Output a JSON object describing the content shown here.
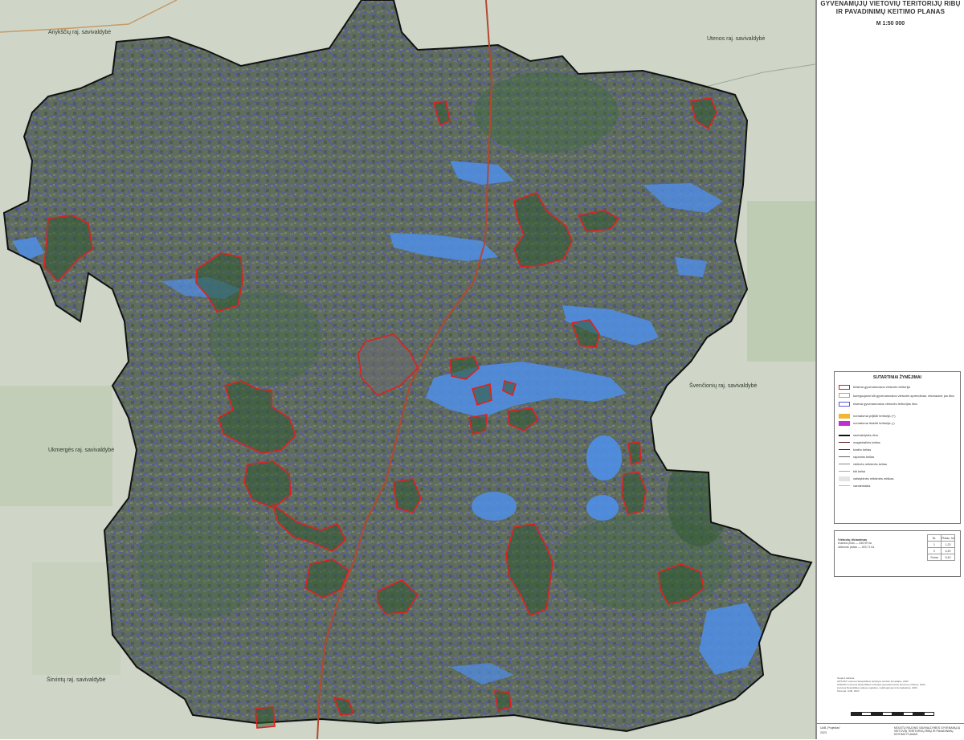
{
  "title": {
    "line1": "GYVENAMŲJŲ VIETOVIŲ TERITORIJŲ RIBŲ",
    "line2": "IR PAVADINIMŲ KEITIMO PLANAS",
    "scale": "M 1:50 000"
  },
  "neighbors": {
    "anyksciai": "Anykščių raj. savivaldybė",
    "utena": "Utenos raj. savivaldybė",
    "svencionys": "Švenčionių raj. savivaldybė",
    "ukmerge": "Ukmergės raj. savivaldybė",
    "sirvintos": "Širvintų raj. savivaldybė"
  },
  "legend": {
    "title": "SUTARTINIAI ŽYMĖJIMAI",
    "items": [
      {
        "label": "būsima gyvenamosios vietovės teritorija",
        "color": "#d81e1e",
        "kind": "box"
      },
      {
        "label": "koreguojami kiti gyvenamosios vietovės sprendiniai, rekreacinė jos riba",
        "color": "#c9a25a",
        "kind": "box"
      },
      {
        "label": "esama gyvenamosios vietovės teritorijos riba",
        "color": "#5a5ad6",
        "kind": "box"
      },
      {
        "label": "numatoma prijiktii teritorija (+)",
        "color": "#f2b632",
        "kind": "fill"
      },
      {
        "label": "numatoma išskirti teritorija (-)",
        "color": "#c02fd2",
        "kind": "fill"
      },
      {
        "label": "savivaldybės riba",
        "color": "#111111",
        "kind": "line"
      },
      {
        "label": "magistralinis kelias",
        "color": "#5a1a1a",
        "kind": "line"
      },
      {
        "label": "krašto kelias",
        "color": "#333333",
        "kind": "line"
      },
      {
        "label": "rajoninis kelias",
        "color": "#666666",
        "kind": "line"
      },
      {
        "label": "vietinės reikšmės kelias",
        "color": "#888888",
        "kind": "line"
      },
      {
        "label": "kiti keliai",
        "color": "#aaaaaa",
        "kind": "line"
      },
      {
        "label": "valstybinės reikšmės miškas",
        "color": "#e4e4e4",
        "kind": "fill"
      },
      {
        "label": "vandentakis",
        "color": "#bbbbbb",
        "kind": "line"
      }
    ]
  },
  "stats": {
    "label": "Vietovių rikiavimas",
    "lines": [
      "esamos ploto — 445,99 ha",
      "siūlomas plotas — 449,71 ha"
    ],
    "table": [
      [
        "Nr.",
        "Plotas, ha"
      ],
      [
        "1",
        "1,23"
      ],
      [
        "2",
        "4,20"
      ],
      [
        "Suma",
        "5,43"
      ]
    ]
  },
  "notes": [
    "Naudoti šaltiniai:",
    "ORT10LT Lietuvos Respublikos teritorijos ortofoto žemėlapis, 2022",
    "GDR10LT Lietuvos Respublikos teritorijos georeferencinių duomenų rinkinys, 2022",
    "Lietuvos Respublikos adresų registras, nekilnojamojo turto kadastras, 2023",
    "Parengė: UAB, 2023"
  ],
  "title_block": {
    "left": "UAB „Projektas\"",
    "left2": "2023",
    "right": "MOLĖTŲ RAJONO SAVIVALDYBĖS GYVENAMŲJŲ VIETOVIŲ TERITORIJŲ RIBŲ IR PAVADINIMŲ KEITIMO PLANAS"
  },
  "colors": {
    "district_fill": "#5d6a5c",
    "parcel_line": "#4a4ad8",
    "lake": "#4f8fe8",
    "settlement_border": "#e02020",
    "outside": "#cfd6c8",
    "highway": "#b5472f",
    "boundary": "#111111"
  }
}
